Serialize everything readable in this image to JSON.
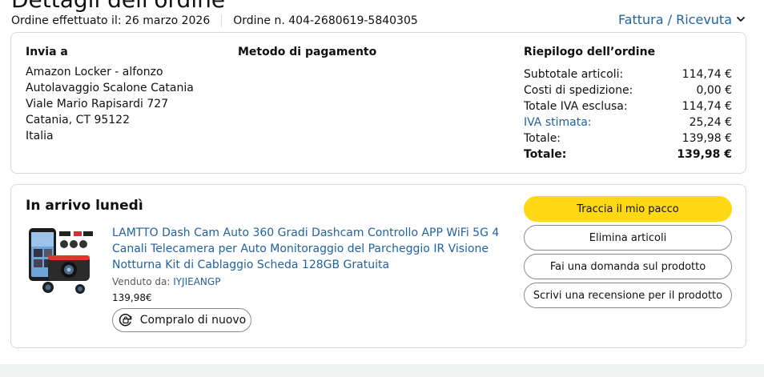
{
  "page": {
    "title": "Dettagli dell'ordine"
  },
  "meta": {
    "order_date": "Ordine effettuato il: 26 marzo 2026",
    "order_number": "Ordine n. 404-2680619-5840305",
    "invoice_link": "Fattura / Ricevuta"
  },
  "shipping": {
    "heading": "Invia a",
    "lines": [
      "Amazon Locker - alfonzo",
      "Autolavaggio Scalone Catania",
      "Viale Mario Rapisardi 727",
      "Catania, CT 95122",
      "Italia"
    ]
  },
  "payment": {
    "heading": "Metodo di pagamento"
  },
  "summary": {
    "heading": "Riepilogo dell’ordine",
    "rows": [
      {
        "label": "Subtotale articoli:",
        "value": "114,74 €"
      },
      {
        "label": "Costi di spedizione:",
        "value": "0,00 €"
      },
      {
        "label": "Totale IVA esclusa:",
        "value": "114,74 €"
      },
      {
        "label": "IVA stimata:",
        "value": "25,24 €"
      },
      {
        "label": "Totale:",
        "value": "139,98 €"
      }
    ],
    "grand_total": {
      "label": "Totale:",
      "value": "139,98 €"
    }
  },
  "delivery": {
    "status": "In arrivo lunedì",
    "product": {
      "title": "LAMTTO Dash Cam Auto 360 Gradi Dashcam Controllo APP WiFi 5G 4 Canali Telecamera per Auto Monitoraggio del Parcheggio IR Visione Notturna Kit di Cablaggio Scheda 128GB Gratuita",
      "seller_prefix": "Venduto da: ",
      "seller_name": "IYJIEANGP",
      "price": "139,98€",
      "buy_again": "Compralo di nuovo",
      "buy_again_icon": "rebuy-icon",
      "image": "dash-cam-product-image"
    },
    "actions": {
      "track": "Traccia il mio pacco",
      "delete": "Elimina articoli",
      "ask": "Fai una domanda sul prodotto",
      "review": "Scrivi una recensione per il prodotto"
    }
  },
  "colors": {
    "link": "#2162a1",
    "primary_button": "#ffd814",
    "border": "#d5d9d9",
    "text": "#0f1111"
  }
}
